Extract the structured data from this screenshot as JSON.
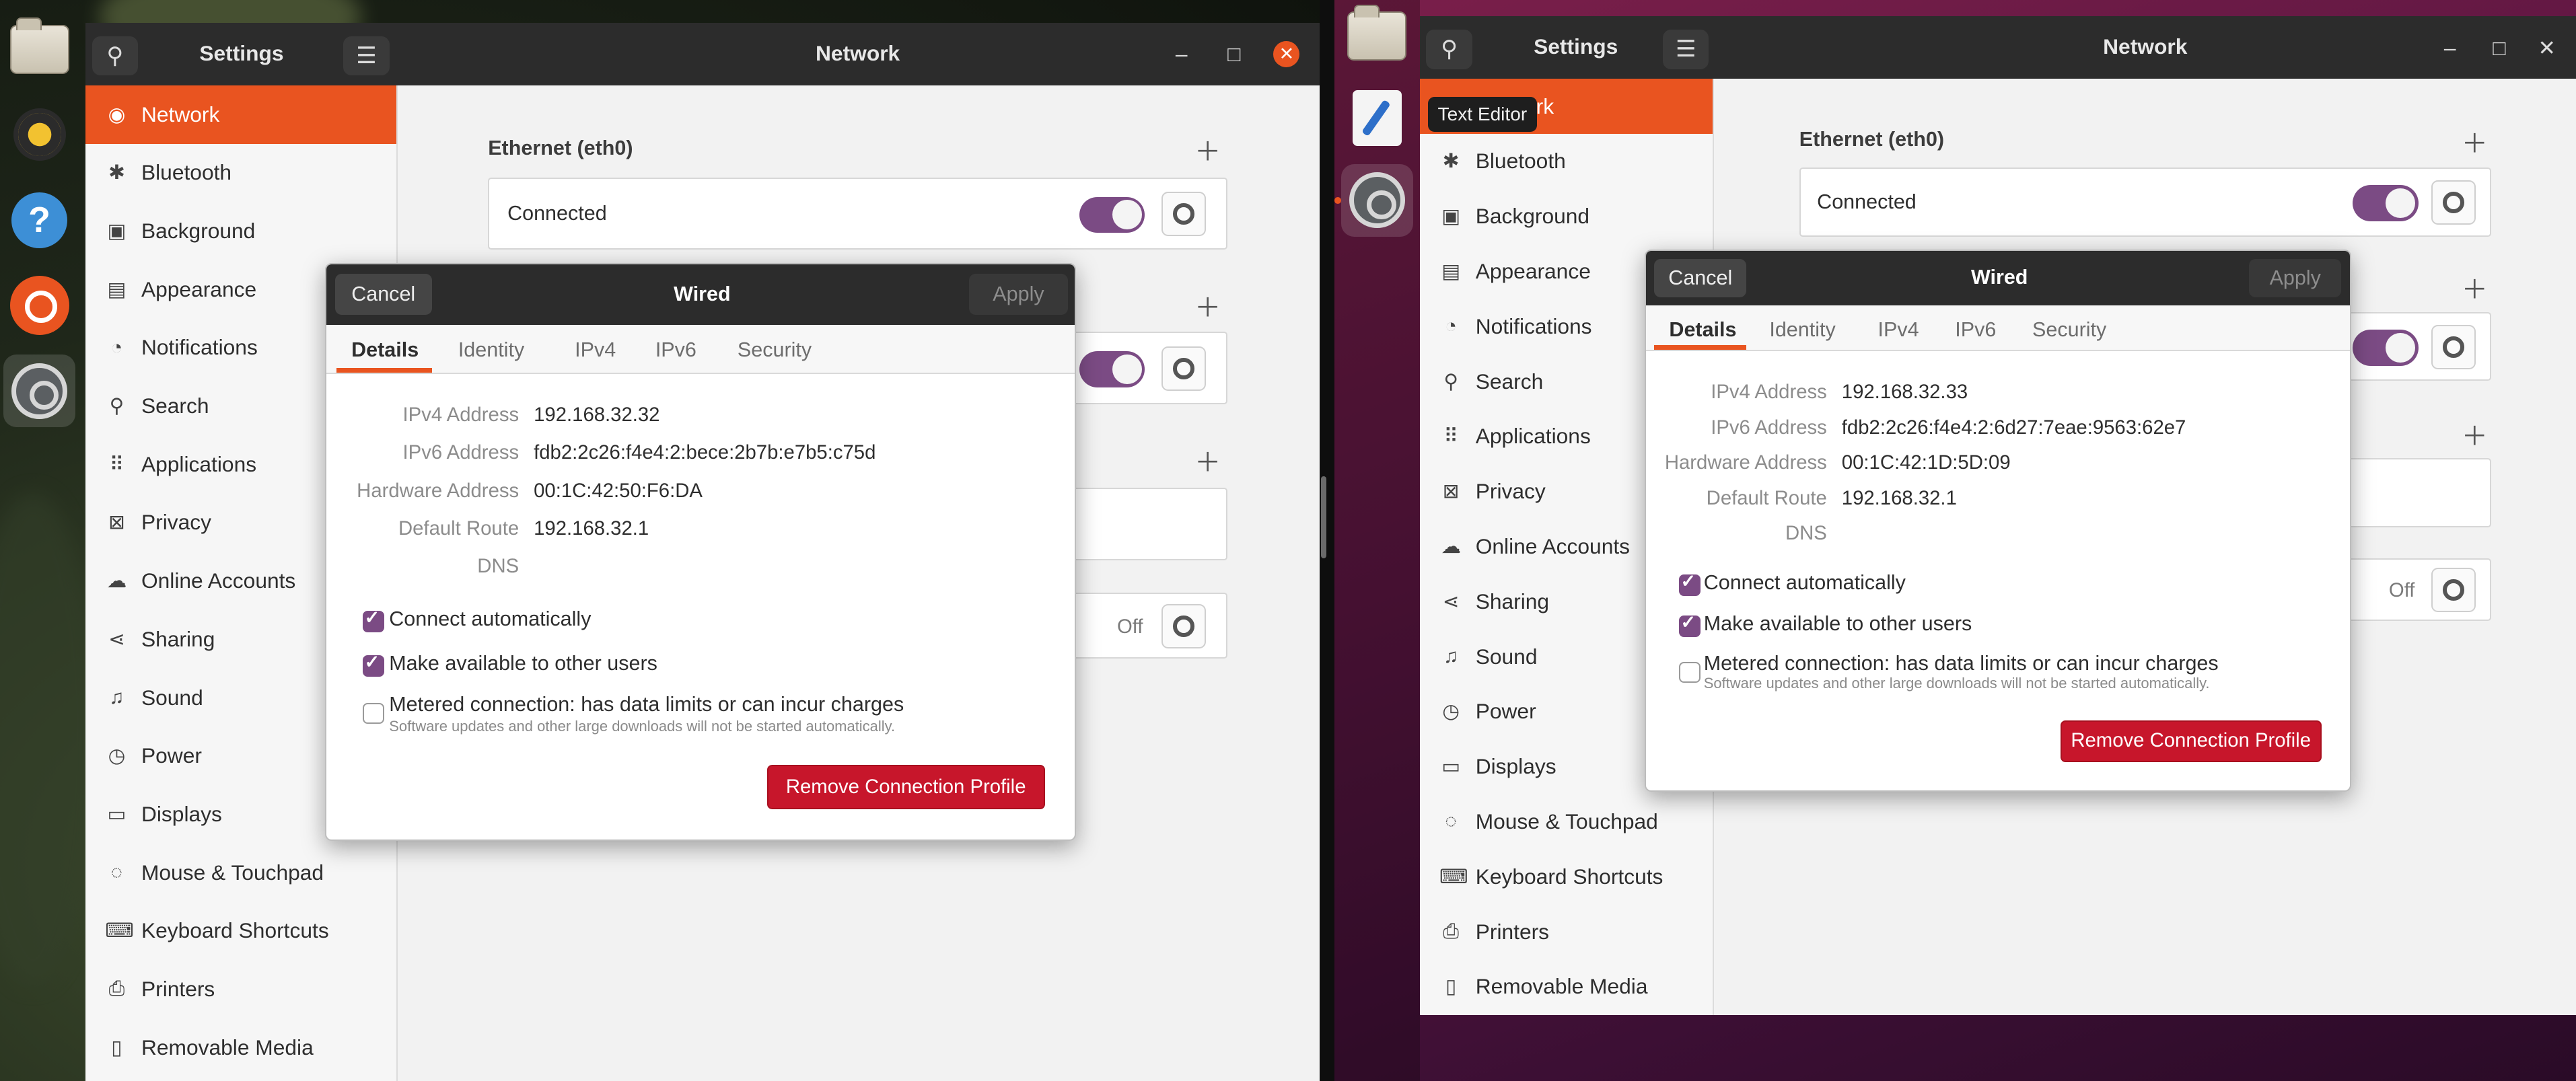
{
  "left": {
    "dock": [
      "files-icon",
      "rhythmbox-icon",
      "help-icon",
      "ubuntu-software-icon",
      "settings-icon"
    ],
    "settings": {
      "sidebar_title": "Settings",
      "panel_title": "Network",
      "sidebar_items": [
        {
          "label": "Network",
          "icon": "◉"
        },
        {
          "label": "Bluetooth",
          "icon": "✱"
        },
        {
          "label": "Background",
          "icon": "▣"
        },
        {
          "label": "Appearance",
          "icon": "▤"
        },
        {
          "label": "Notifications",
          "icon": "◔"
        },
        {
          "label": "Search",
          "icon": "⚲"
        },
        {
          "label": "Applications",
          "icon": "⠿"
        },
        {
          "label": "Privacy",
          "icon": "⊠"
        },
        {
          "label": "Online Accounts",
          "icon": "☁"
        },
        {
          "label": "Sharing",
          "icon": "⋖"
        },
        {
          "label": "Sound",
          "icon": "♫"
        },
        {
          "label": "Power",
          "icon": "◷"
        },
        {
          "label": "Displays",
          "icon": "▭"
        },
        {
          "label": "Mouse & Touchpad",
          "icon": "◌"
        },
        {
          "label": "Keyboard Shortcuts",
          "icon": "⌨"
        },
        {
          "label": "Printers",
          "icon": "⎙"
        },
        {
          "label": "Removable Media",
          "icon": "▯"
        }
      ],
      "ethernet_title": "Ethernet (eth0)",
      "connected_label": "Connected",
      "off_label": "Off"
    },
    "dialog": {
      "cancel": "Cancel",
      "title": "Wired",
      "apply": "Apply",
      "tabs": [
        "Details",
        "Identity",
        "IPv4",
        "IPv6",
        "Security"
      ],
      "details": [
        {
          "key": "IPv4 Address",
          "value": "192.168.32.32"
        },
        {
          "key": "IPv6 Address",
          "value": "fdb2:2c26:f4e4:2:bece:2b7b:e7b5:c75d"
        },
        {
          "key": "Hardware Address",
          "value": "00:1C:42:50:F6:DA"
        },
        {
          "key": "Default Route",
          "value": "192.168.32.1"
        },
        {
          "key": "DNS",
          "value": ""
        }
      ],
      "connect_auto": "Connect automatically",
      "available_users": "Make available to other users",
      "metered": "Metered connection: has data limits or can incur charges",
      "metered_sub": "Software updates and other large downloads will not be started automatically.",
      "remove": "Remove Connection Profile"
    }
  },
  "right": {
    "tooltip": "Text Editor",
    "settings": {
      "sidebar_title": "Settings",
      "panel_title": "Network",
      "sidebar_items": [
        {
          "label": "Network",
          "icon": "◉"
        },
        {
          "label": "Bluetooth",
          "icon": "✱"
        },
        {
          "label": "Background",
          "icon": "▣"
        },
        {
          "label": "Appearance",
          "icon": "▤"
        },
        {
          "label": "Notifications",
          "icon": "◔"
        },
        {
          "label": "Search",
          "icon": "⚲"
        },
        {
          "label": "Applications",
          "icon": "⠿"
        },
        {
          "label": "Privacy",
          "icon": "⊠"
        },
        {
          "label": "Online Accounts",
          "icon": "☁"
        },
        {
          "label": "Sharing",
          "icon": "⋖"
        },
        {
          "label": "Sound",
          "icon": "♫"
        },
        {
          "label": "Power",
          "icon": "◷"
        },
        {
          "label": "Displays",
          "icon": "▭"
        },
        {
          "label": "Mouse & Touchpad",
          "icon": "◌"
        },
        {
          "label": "Keyboard Shortcuts",
          "icon": "⌨"
        },
        {
          "label": "Printers",
          "icon": "⎙"
        },
        {
          "label": "Removable Media",
          "icon": "▯"
        }
      ],
      "ethernet_title": "Ethernet (eth0)",
      "connected_label": "Connected",
      "off_label": "Off"
    },
    "dialog": {
      "cancel": "Cancel",
      "title": "Wired",
      "apply": "Apply",
      "tabs": [
        "Details",
        "Identity",
        "IPv4",
        "IPv6",
        "Security"
      ],
      "details": [
        {
          "key": "IPv4 Address",
          "value": "192.168.32.33"
        },
        {
          "key": "IPv6 Address",
          "value": "fdb2:2c26:f4e4:2:6d27:7eae:9563:62e7"
        },
        {
          "key": "Hardware Address",
          "value": "00:1C:42:1D:5D:09"
        },
        {
          "key": "Default Route",
          "value": "192.168.32.1"
        },
        {
          "key": "DNS",
          "value": ""
        }
      ],
      "connect_auto": "Connect automatically",
      "available_users": "Make available to other users",
      "metered": "Metered connection: has data limits or can incur charges",
      "metered_sub": "Software updates and other large downloads will not be started automatically.",
      "remove": "Remove Connection Profile"
    }
  }
}
